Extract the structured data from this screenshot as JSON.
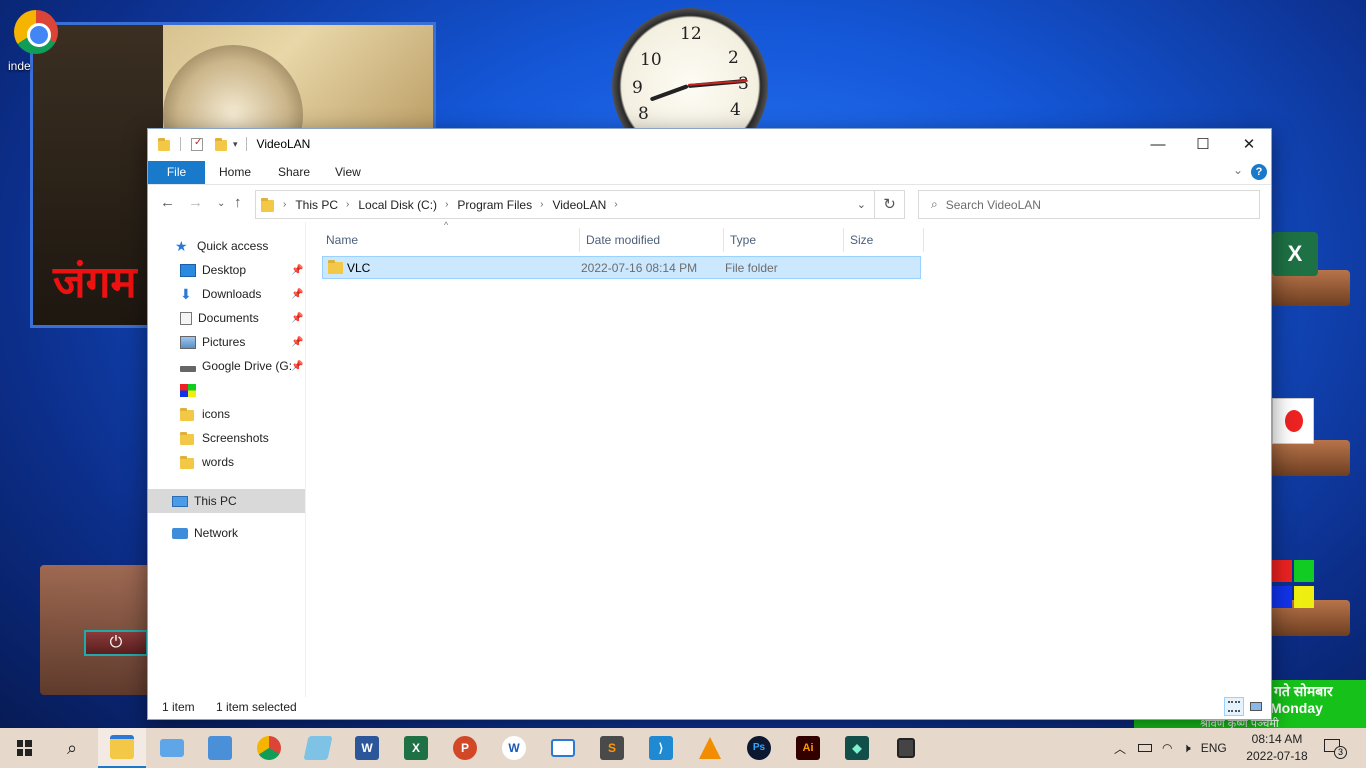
{
  "desktop": {
    "shortcut_label": "inde",
    "photo_text": "जंगम",
    "date_widget": {
      "line1": "गते सोमबार",
      "line2": "Monday",
      "line3": "श्रावण  कृष्ण पञ्चमी"
    },
    "excel_letter": "X"
  },
  "window": {
    "title": "VideoLAN",
    "controls": {
      "minimize": "—",
      "maximize": "☐",
      "close": "✕"
    }
  },
  "ribbon": {
    "tabs": [
      "File",
      "Home",
      "Share",
      "View"
    ],
    "help": "?"
  },
  "address": {
    "crumbs": [
      "This PC",
      "Local Disk (C:)",
      "Program Files",
      "VideoLAN"
    ]
  },
  "search": {
    "placeholder": "Search VideoLAN"
  },
  "nav_pane": {
    "quick_access": "Quick access",
    "items": [
      "Desktop",
      "Downloads",
      "Documents",
      "Pictures",
      "Google Drive (G:",
      "",
      "icons",
      "Screenshots",
      "words"
    ],
    "this_pc": "This PC",
    "network": "Network"
  },
  "columns": [
    "Name",
    "Date modified",
    "Type",
    "Size"
  ],
  "files": [
    {
      "name": "VLC",
      "date": "2022-07-16 08:14 PM",
      "type": "File folder",
      "size": ""
    }
  ],
  "status": {
    "count": "1 item",
    "selected": "1 item selected"
  },
  "taskbar": {
    "apps": [
      "start",
      "search",
      "file-explorer",
      "this-pc",
      "control-panel",
      "chrome",
      "notepad",
      "word",
      "excel",
      "powerpoint",
      "wordweb",
      "task-view",
      "sublime-text",
      "vscode",
      "vlc",
      "photoshop",
      "illustrator",
      "filmora",
      "calculator"
    ],
    "lang": "ENG",
    "time": "08:14 AM",
    "date": "2022-07-18",
    "notifications": "3"
  },
  "colors": {
    "accent": "#1979ca",
    "selection": "#cce8ff",
    "selection_border": "#99d1ff",
    "folder": "#f3c846"
  }
}
